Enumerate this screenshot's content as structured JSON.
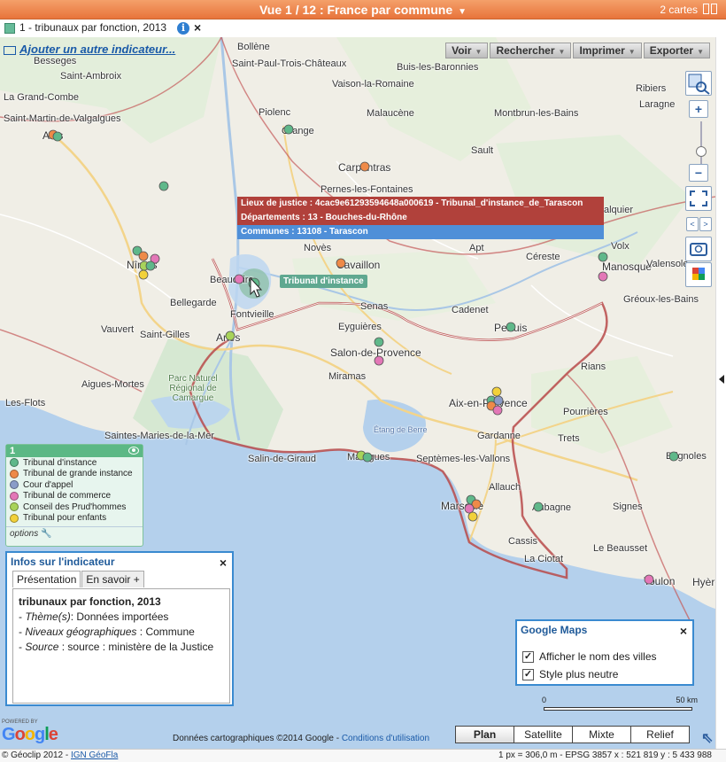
{
  "topbar": {
    "title": "Vue 1 / 12 : France par commune",
    "cards_label": "2 cartes"
  },
  "indicator": {
    "label": "1 - tribunaux par fonction, 2013",
    "add_link": "Ajouter un autre indicateur..."
  },
  "toolbar": {
    "items": [
      "Voir",
      "Rechercher",
      "Imprimer",
      "Exporter"
    ]
  },
  "tooltip": {
    "line1": "Lieux de justice : 4cac9e61293594648a000619 - Tribunal_d'instance_de_Tarascon",
    "line2": "Départements : 13 - Bouches-du-Rhône",
    "line3": "Communes : 13108 - Tarascon",
    "tag": "Tribunal d'instance"
  },
  "map_labels": [
    "Besseges",
    "Saint-Ambroix",
    "La Grand-Combe",
    "Saint-Martin-de-Valgalgues",
    "Alès",
    "Bollène",
    "Saint-Paul-Trois-Châteaux",
    "Buis-les-Baronnies",
    "Vaison-la-Romaine",
    "Piolenc",
    "Orange",
    "Malaucène",
    "Montbrun-les-Bains",
    "Ribiers",
    "Laragne",
    "Sault",
    "Carpentras",
    "Pernes-les-Fontaines",
    "Forcalquier",
    "Nîmes",
    "Novès",
    "Apt",
    "Volx",
    "Manosque",
    "Valensole",
    "Beaucaire",
    "Cavaillon",
    "Céreste",
    "Gréoux-les-Bains",
    "Bellegarde",
    "Fontvieille",
    "Senas",
    "Cadenet",
    "Pertuis",
    "Vauvert",
    "Saint-Gilles",
    "Arles",
    "Eyguières",
    "Salon-de-Provence",
    "Rians",
    "Parc Naturel Régional de Camargue",
    "Miramas",
    "Aigues-Mortes",
    "Aix-en-Provence",
    "Pourrières",
    "Les-Flots",
    "Gardanne",
    "Trets",
    "Saintes-Maries-de-la-Mer",
    "Étang de Berre",
    "Martigues",
    "Septèmes-les-Vallons",
    "Salin-de-Giraud",
    "Brignoles",
    "Allauch",
    "Marseille",
    "Aubagne",
    "Signes",
    "Cassis",
    "La Ciotat",
    "Le Beausset",
    "Toulon",
    "Hyères"
  ],
  "legend": {
    "header": "1",
    "items": [
      {
        "label": "Tribunal d'instance",
        "color": "#5fb88a"
      },
      {
        "label": "Tribunal de grande instance",
        "color": "#ee8a48"
      },
      {
        "label": "Cour d'appel",
        "color": "#8a9cc8"
      },
      {
        "label": "Tribunal de commerce",
        "color": "#e377b7"
      },
      {
        "label": "Conseil des Prud'hommes",
        "color": "#a8d35a"
      },
      {
        "label": "Tribunal pour enfants",
        "color": "#f2d13a"
      }
    ],
    "options_label": "options"
  },
  "infopanel": {
    "title": "Infos sur l'indicateur",
    "tabs": [
      "Présentation",
      "En savoir +"
    ],
    "heading": "tribunaux par fonction, 2013",
    "theme_key": "Thème(s)",
    "theme_val": "Données importées",
    "levels_key": "Niveaux géographiques",
    "levels_val": "Commune",
    "source_key": "Source",
    "source_val": "source : ministère de la Justice"
  },
  "gmpanel": {
    "title": "Google Maps",
    "opt1": "Afficher le nom des villes",
    "opt2": "Style plus neutre"
  },
  "scale": {
    "min": "0",
    "max": "50 km"
  },
  "footer": {
    "powered_by": "POWERED BY",
    "google": "Google",
    "copyright": "Données cartographiques ©2014 Google - ",
    "conditions": "Conditions d'utilisation",
    "map_types": [
      "Plan",
      "Satellite",
      "Mixte",
      "Relief"
    ],
    "status_left": "© Géoclip 2012 - ",
    "status_ign": "IGN GéoFla",
    "status_right": "1 px = 306,0 m - EPSG 3857  x : 521 819   y : 5 433 988"
  }
}
